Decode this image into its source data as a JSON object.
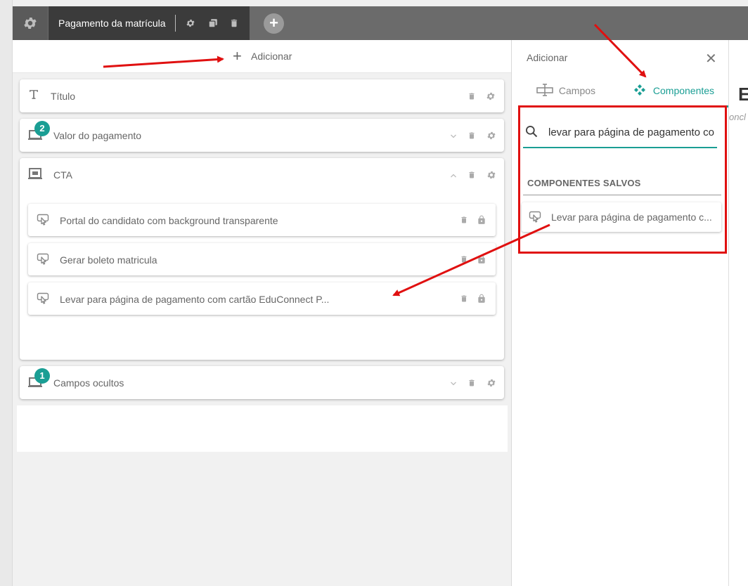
{
  "toolbar": {
    "page_title": "Pagamento da matrícula",
    "add_icon": "plus-icon",
    "settings_icon": "gear-icon",
    "copy_icon": "copy-icon",
    "delete_icon": "trash-icon"
  },
  "builder": {
    "add_label": "Adicionar",
    "sections": [
      {
        "label": "Título",
        "icon": "text-icon"
      },
      {
        "label": "Valor do pagamento",
        "icon": "container-icon",
        "badge": "2"
      },
      {
        "label": "CTA",
        "icon": "container-icon",
        "expanded": true,
        "children": [
          {
            "label": "Portal do candidato com background transparente",
            "icon": "cta-icon"
          },
          {
            "label": "Gerar boleto matricula",
            "icon": "cta-icon"
          },
          {
            "label": "Levar para página de pagamento com cartão EduConnect P...",
            "icon": "cta-icon"
          }
        ]
      },
      {
        "label": "Campos ocultos",
        "icon": "container-icon",
        "badge": "1"
      }
    ]
  },
  "panel": {
    "title": "Adicionar",
    "tabs": [
      {
        "label": "Campos",
        "icon": "fields-icon",
        "active": false
      },
      {
        "label": "Componentes",
        "icon": "components-icon",
        "active": true
      }
    ],
    "search_value": "levar para página de pagamento co",
    "saved_heading": "COMPONENTES SALVOS",
    "saved_items": [
      {
        "label": "Levar para página de pagamento c...",
        "icon": "cta-icon"
      }
    ]
  },
  "background": {
    "heading_fragment": "E",
    "sub_fragment": "oncl"
  },
  "colors": {
    "accent": "#1a9e94",
    "annotation": "#e01010",
    "toolbar": "#6b6b6b",
    "active_tab": "#3b3b3b"
  }
}
